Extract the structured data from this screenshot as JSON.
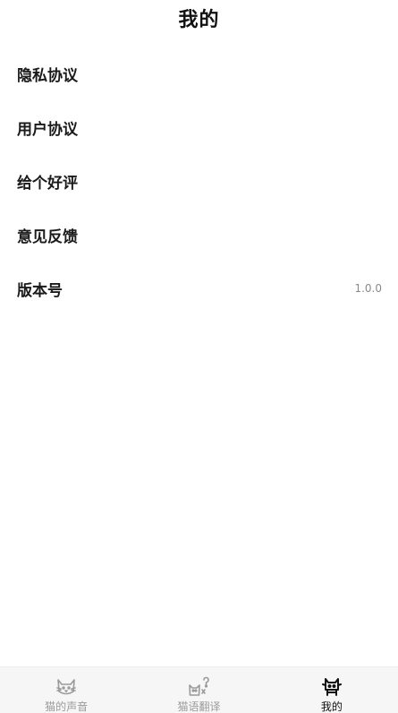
{
  "header": {
    "title": "我的"
  },
  "menu": {
    "items": [
      {
        "label": "隐私协议"
      },
      {
        "label": "用户协议"
      },
      {
        "label": "给个好评"
      },
      {
        "label": "意见反馈"
      },
      {
        "label": "版本号",
        "value": "1.0.0"
      }
    ]
  },
  "tabbar": {
    "tabs": [
      {
        "label": "猫的声音",
        "icon": "cat-face-icon",
        "active": false
      },
      {
        "label": "猫语翻译",
        "icon": "cat-translate-icon",
        "active": false
      },
      {
        "label": "我的",
        "icon": "profile-cat-icon",
        "active": true
      }
    ],
    "colors": {
      "active": "#111111",
      "inactive": "#9a9a9a"
    }
  }
}
